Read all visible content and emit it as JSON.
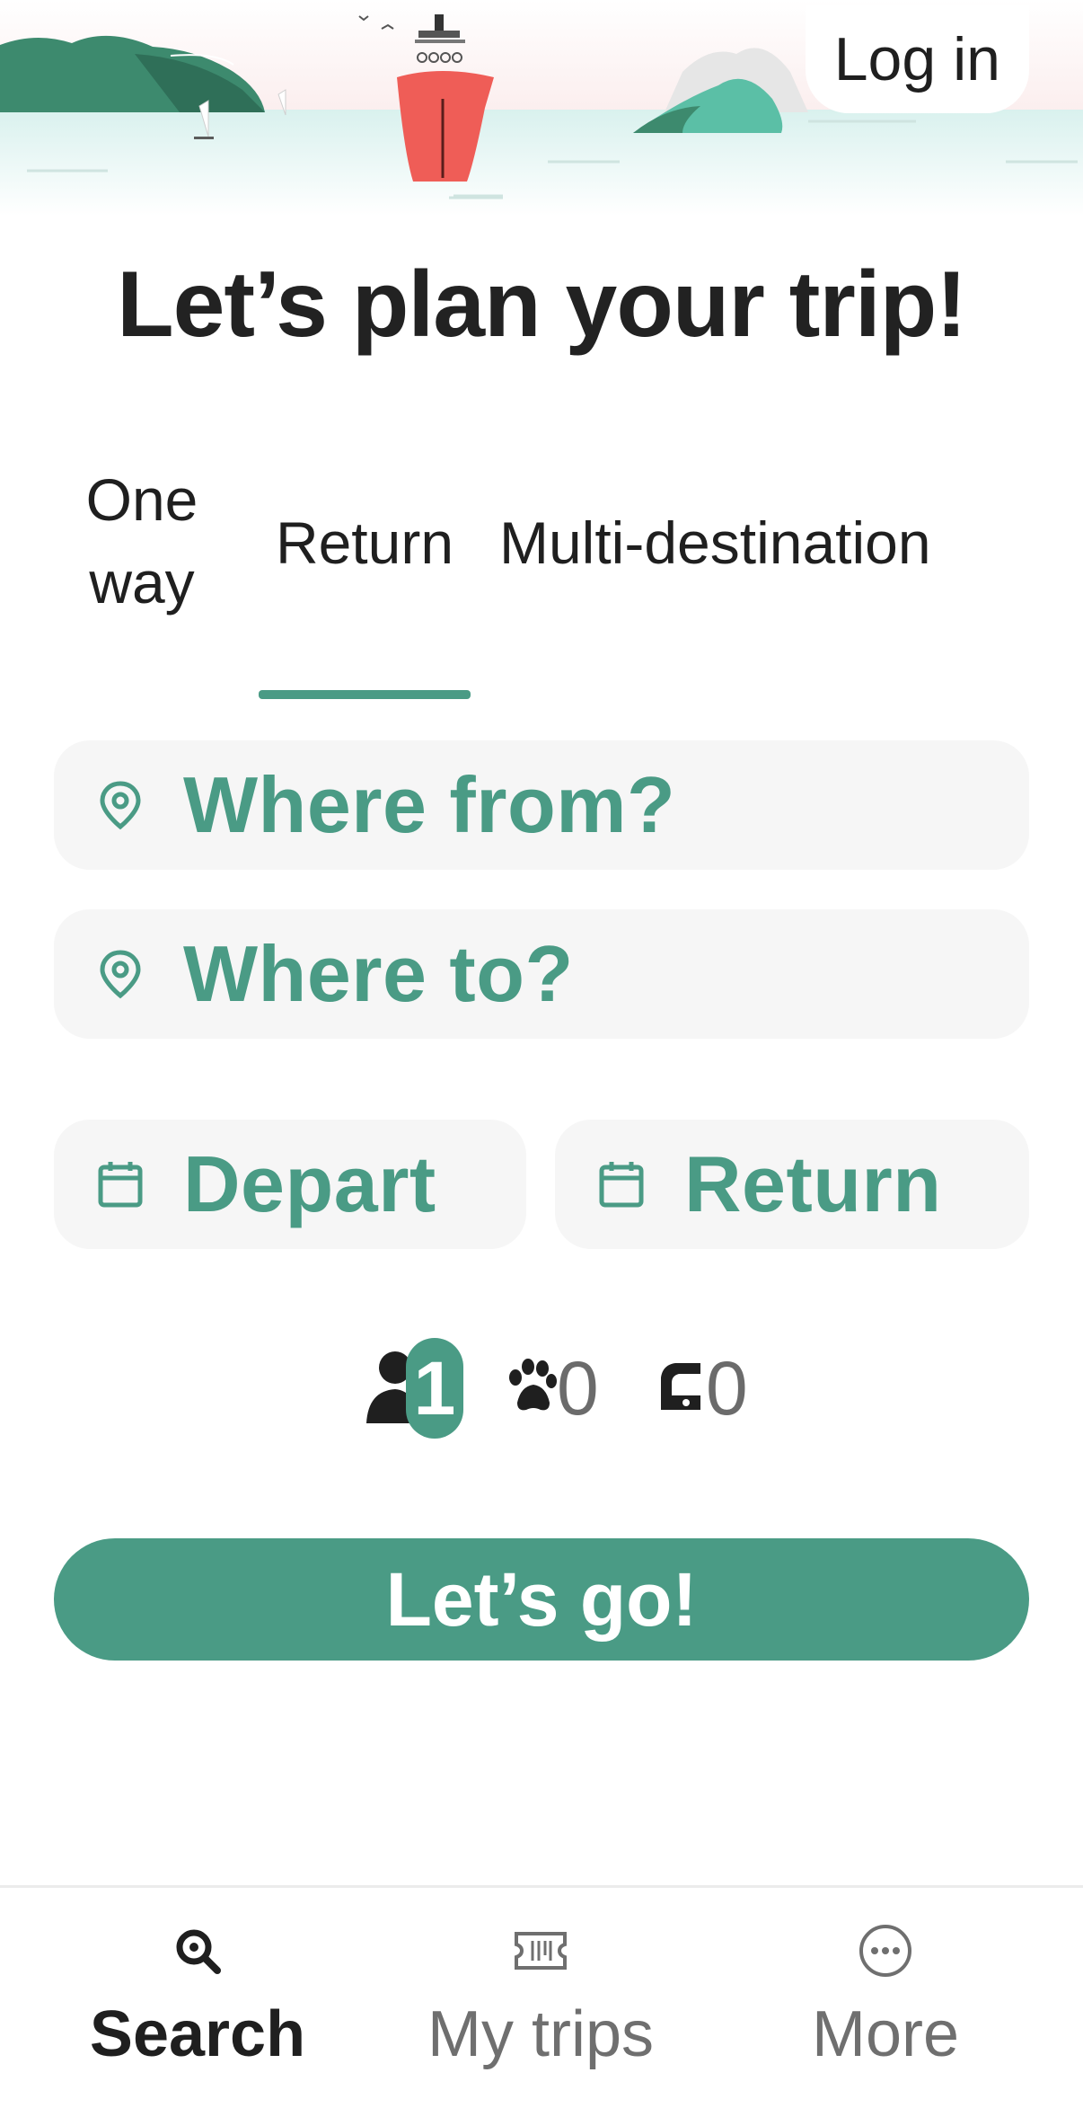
{
  "header": {
    "login_label": "Log in"
  },
  "page": {
    "title": "Let’s plan your trip!"
  },
  "tabs": {
    "one_way_line1": "One",
    "one_way_line2": "way",
    "return": "Return",
    "multi": "Multi-destination",
    "selected": "Return"
  },
  "search": {
    "from_placeholder": "Where from?",
    "to_placeholder": "Where to?",
    "depart_placeholder": "Depart",
    "return_placeholder": "Return"
  },
  "passengers": {
    "people": "1",
    "pets": "0",
    "vehicles": "0"
  },
  "actions": {
    "go_label": "Let’s go!"
  },
  "bottom_nav": {
    "search": "Search",
    "trips": "My trips",
    "more": "More"
  },
  "colors": {
    "accent": "#4a9b85",
    "ship": "#ef5d57",
    "field_bg": "#f6f6f6"
  },
  "icons": [
    "location-pin-icon",
    "calendar-icon",
    "person-icon",
    "paw-icon",
    "car-icon",
    "search-icon",
    "ticket-icon",
    "more-dots-icon"
  ]
}
